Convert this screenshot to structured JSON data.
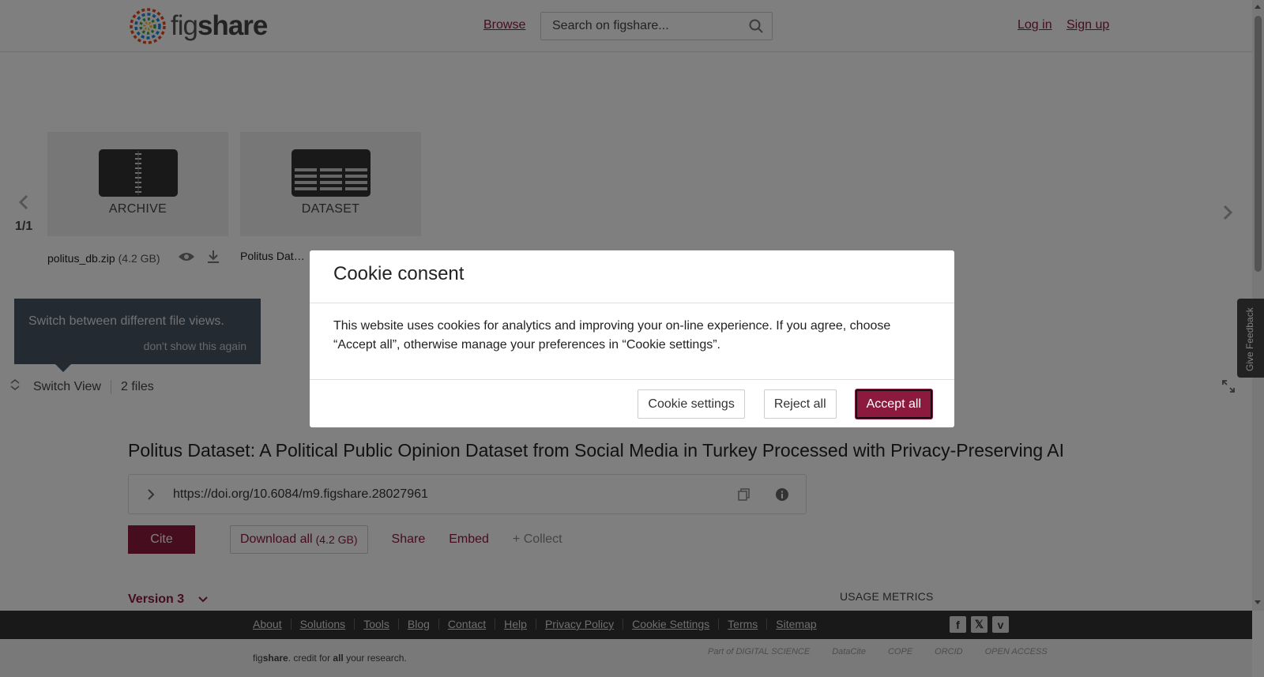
{
  "header": {
    "logo_text_a": "fig",
    "logo_text_b": "share",
    "browse": "Browse",
    "search_placeholder": "Search on figshare...",
    "login": "Log in",
    "signup": "Sign up"
  },
  "viewer": {
    "pager": "1/1",
    "tiles": [
      {
        "label": "ARCHIVE"
      },
      {
        "label": "DATASET"
      }
    ],
    "files": [
      {
        "name": "politus_db.zip",
        "size": "(4.2 GB)"
      },
      {
        "name": "Politus Dat…"
      }
    ],
    "tip": {
      "text": "Switch between different file views.",
      "dismiss": "don't show this again"
    },
    "switch_view": "Switch View",
    "file_count": "2 files"
  },
  "article": {
    "title": "Politus Dataset: A Political Public Opinion Dataset from Social Media in Turkey Processed with Privacy-Preserving AI",
    "doi": "https://doi.org/10.6084/m9.figshare.28027961",
    "cite": "Cite",
    "download_all": "Download all",
    "download_size": "(4.2 GB)",
    "share": "Share",
    "embed": "Embed",
    "collect": "+ Collect",
    "version": "Version 3",
    "usage_metrics": "USAGE METRICS"
  },
  "footer": {
    "links": [
      "About",
      "Solutions",
      "Tools",
      "Blog",
      "Contact",
      "Help",
      "Privacy Policy",
      "Cookie Settings",
      "Terms",
      "Sitemap"
    ],
    "tagline_pre": "fig",
    "tagline_bold": "share",
    "tagline_mid": ". credit for ",
    "tagline_all": "all",
    "tagline_post": " your research.",
    "partners": [
      "Part of DIGITAL SCIENCE",
      "DataCite",
      "COPE",
      "ORCID",
      "OPEN ACCESS"
    ]
  },
  "feedback": "Give Feedback",
  "cookie": {
    "title": "Cookie consent",
    "body": "This website uses cookies for analytics and improving your on-line experience. If you agree, choose “Accept all”, otherwise manage your preferences in “Cookie settings”.",
    "settings": "Cookie settings",
    "reject": "Reject all",
    "accept": "Accept all"
  },
  "colors": {
    "brand": "#8c1a3f",
    "footer": "#333333",
    "tip": "#475463"
  }
}
